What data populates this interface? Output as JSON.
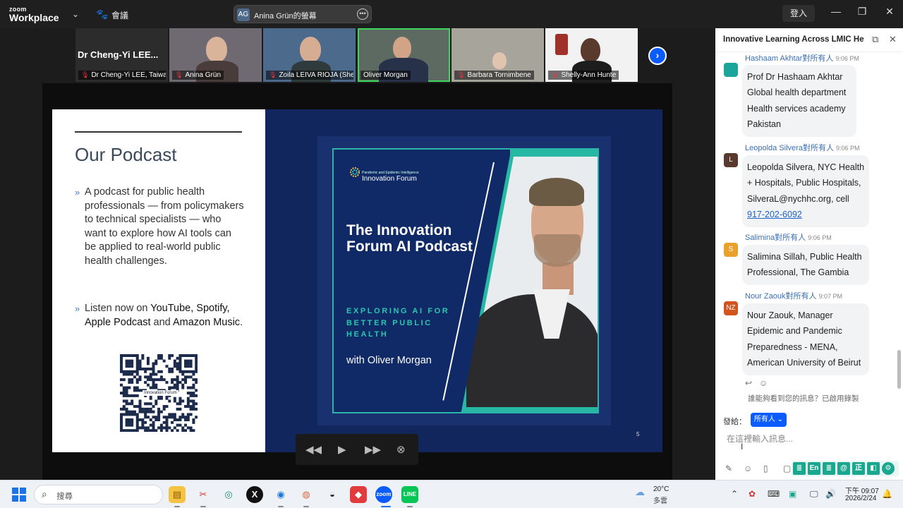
{
  "app": {
    "logo_top": "zoom",
    "logo_bottom": "Workplace",
    "meeting_label": "會議",
    "share_initials": "AG",
    "share_title": "Anina Grün的螢幕",
    "sign_in": "登入"
  },
  "gallery": {
    "tiles": [
      {
        "name": "Dr Cheng-Yi LEE, Taiwa...",
        "big_name": "Dr Cheng-Yi LEE..."
      },
      {
        "name": "Anina Grün"
      },
      {
        "name": "Zoila LEIVA RIOJA (She..."
      },
      {
        "name": "Oliver Morgan"
      },
      {
        "name": "Barbara Tornimbene"
      },
      {
        "name": "Shelly-Ann Hunte"
      }
    ]
  },
  "slide": {
    "title": "Our Podcast",
    "bullet1": "A podcast for public health professionals — from policymakers to technical specialists — who want to explore how AI tools can be applied to real-world public health challenges.",
    "bullet2_pre": "Listen now on ",
    "bullet2_b1": "YouTube, Spotify, Apple Podcast",
    "bullet2_mid": " and ",
    "bullet2_b2": "Amazon Music",
    "bullet2_post": ".",
    "poster_brand_small": "Pandemic and Epidemic Intelligence",
    "poster_brand": "Innovation Forum",
    "poster_title": "The Innovation Forum AI Podcast",
    "poster_sub": "EXPLORING AI FOR BETTER PUBLIC HEALTH",
    "poster_with": "with Oliver Morgan",
    "qr_label": "Innovation Forum",
    "slide_number": "5"
  },
  "chat": {
    "title": "Innovative Learning Across LMIC Hea...",
    "messages": [
      {
        "sender": "Hashaam Akhtar對所有人",
        "time": "9:06 PM",
        "initials": "",
        "lines": [
          "Prof Dr Hashaam Akhtar",
          "Global health department",
          "Health services academy",
          "Pakistan"
        ]
      },
      {
        "sender": "Leopolda Silvera對所有人",
        "time": "9:06 PM",
        "initials": "L",
        "lines": [
          "Leopolda Silvera,  NYC Health",
          "+ Hospitals, Public Hospitals,",
          "SilveraL@nychhc.org, cell"
        ],
        "link": "917-202-6092"
      },
      {
        "sender": "Salimina對所有人",
        "time": "9:06 PM",
        "initials": "S",
        "lines": [
          "Salimina Sillah, Public Health",
          "Professional, The Gambia"
        ]
      },
      {
        "sender": "Nour Zaouk對所有人",
        "time": "9:07 PM",
        "initials": "NZ",
        "lines": [
          "Nour Zaouk, Manager",
          "Epidemic and Pandemic",
          "Preparedness - MENA,",
          "American University of Beirut"
        ]
      }
    ],
    "who_can_see": "誰能夠看到您的訊息？已啟用錄製",
    "send_to_label": "發給：",
    "send_to_value": "所有人",
    "input_placeholder": "在這裡輸入訊息..."
  },
  "taskbar": {
    "search_placeholder": "搜尋",
    "weather_temp": "20°C",
    "weather_desc": "多雲",
    "time": "下午 09:07",
    "date": "2026/2/24"
  }
}
